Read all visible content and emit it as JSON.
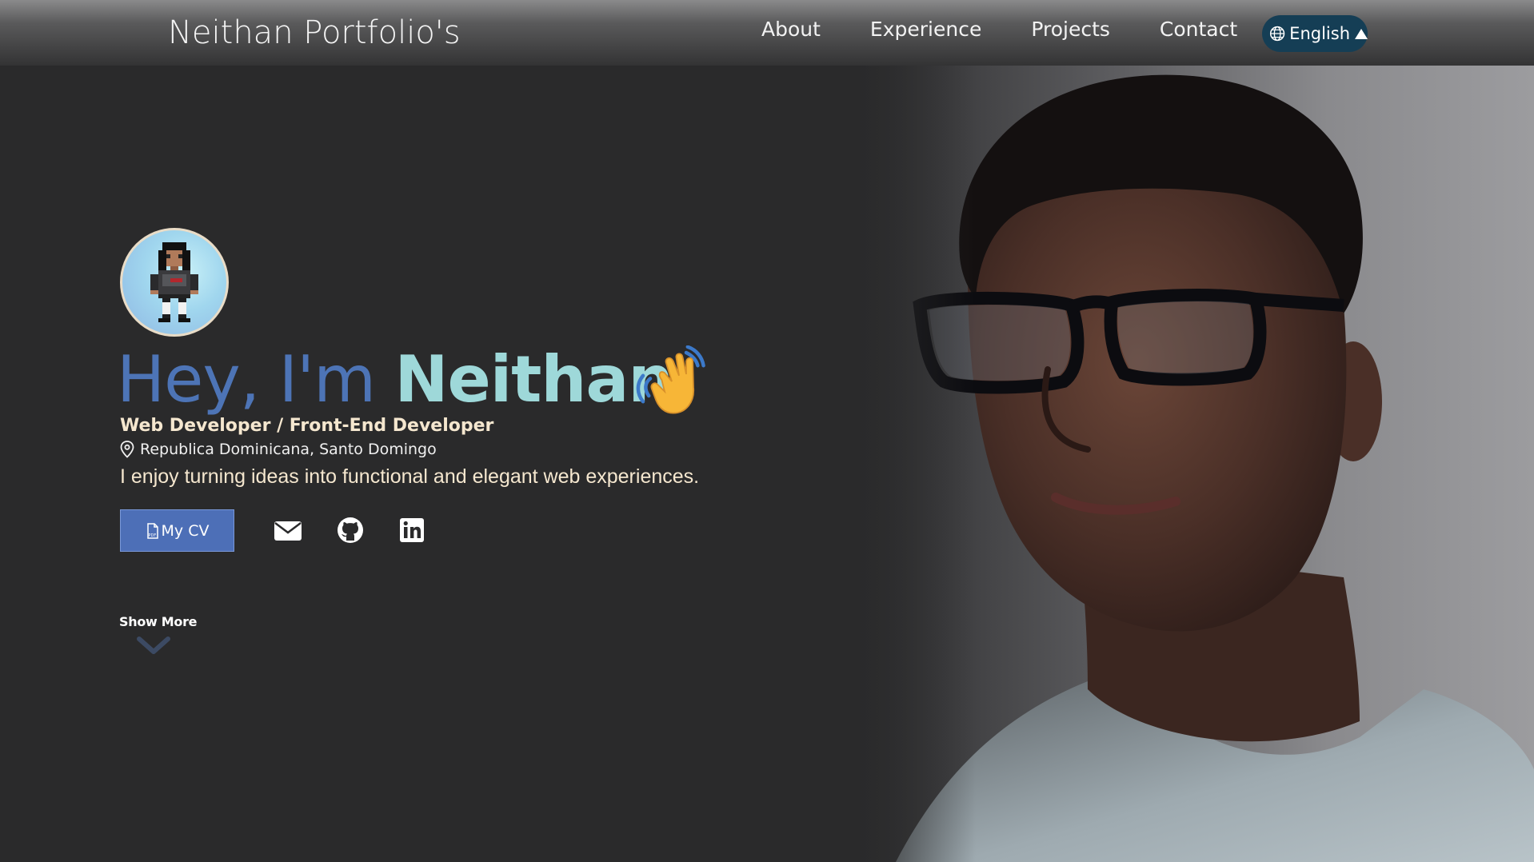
{
  "header": {
    "brand": "Neithan Portfolio's",
    "nav": [
      "About",
      "Experience",
      "Projects",
      "Contact"
    ],
    "language": "English"
  },
  "hero": {
    "greeting": "Hey, I'm ",
    "name": "Neithan",
    "role": "Web Developer / Front-End Developer",
    "location": "Republica Dominicana, Santo Domingo",
    "tagline": "I enjoy turning ideas into functional and elegant web experiences.",
    "cv_label": "My CV",
    "show_more": "Show More"
  },
  "colors": {
    "accent_blue": "#4d74b6",
    "accent_teal": "#9ed8d9",
    "cream": "#f5e7cf",
    "background": "#2a2a2b",
    "language_pill": "#153e55"
  },
  "icons": {
    "language": "globe-icon",
    "location": "map-pin-icon",
    "cv": "document-icon",
    "social": [
      "mail-icon",
      "github-icon",
      "linkedin-icon"
    ],
    "scroll": "chevron-down-icon",
    "greeting": "waving-hand-icon"
  }
}
